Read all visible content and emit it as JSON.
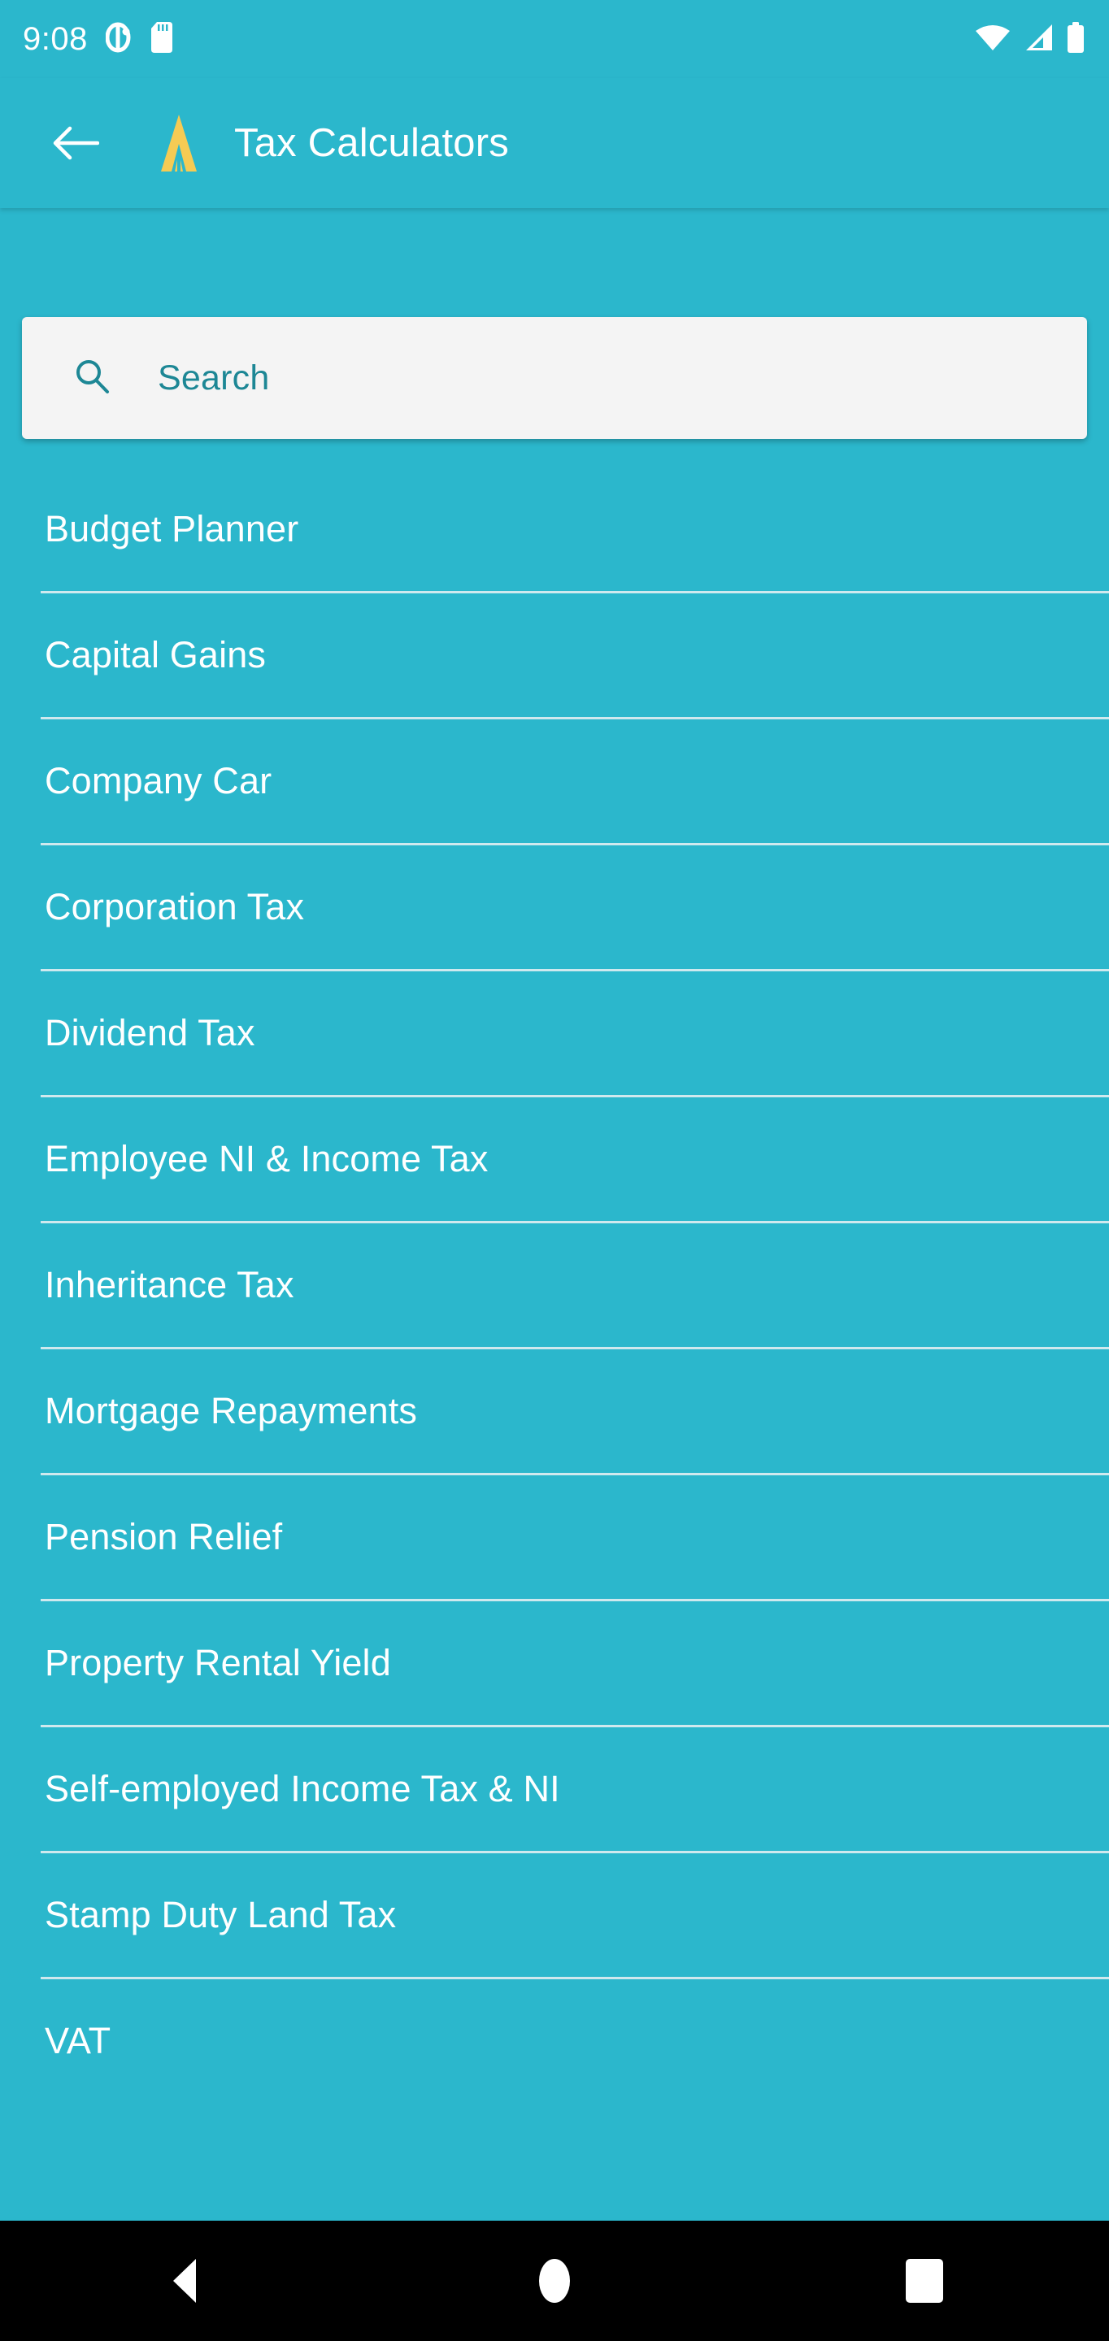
{
  "theme": {
    "primary": "#2bb7cc",
    "accent": "#f5cb54",
    "on_primary": "#ffffff",
    "search_bg": "#f4f4f4",
    "search_text": "#1d8795",
    "divider": "#cfe9ee",
    "navbar_bg": "#000000"
  },
  "status_bar": {
    "clock": "9:08",
    "left_icons": [
      {
        "name": "do-not-disturb-icon"
      },
      {
        "name": "sd-card-icon"
      }
    ],
    "right_icons": [
      {
        "name": "wifi-icon"
      },
      {
        "name": "cellular-signal-icon"
      },
      {
        "name": "battery-full-icon"
      }
    ]
  },
  "app_bar": {
    "back_label": "Back",
    "logo_name": "app-logo-icon",
    "title": "Tax Calculators"
  },
  "search": {
    "icon_name": "search-icon",
    "placeholder": "Search",
    "value": ""
  },
  "calculator_list": {
    "items": [
      {
        "label": "Budget Planner"
      },
      {
        "label": "Capital Gains"
      },
      {
        "label": "Company Car"
      },
      {
        "label": "Corporation Tax"
      },
      {
        "label": "Dividend Tax"
      },
      {
        "label": "Employee NI & Income Tax"
      },
      {
        "label": "Inheritance Tax"
      },
      {
        "label": "Mortgage Repayments"
      },
      {
        "label": "Pension Relief"
      },
      {
        "label": "Property Rental Yield"
      },
      {
        "label": "Self-employed Income Tax & NI"
      },
      {
        "label": "Stamp Duty Land Tax"
      },
      {
        "label": "VAT"
      }
    ]
  },
  "nav_bar": {
    "buttons": [
      {
        "name": "nav-back-button",
        "label": "Back"
      },
      {
        "name": "nav-home-button",
        "label": "Home"
      },
      {
        "name": "nav-recents-button",
        "label": "Recents"
      }
    ]
  }
}
